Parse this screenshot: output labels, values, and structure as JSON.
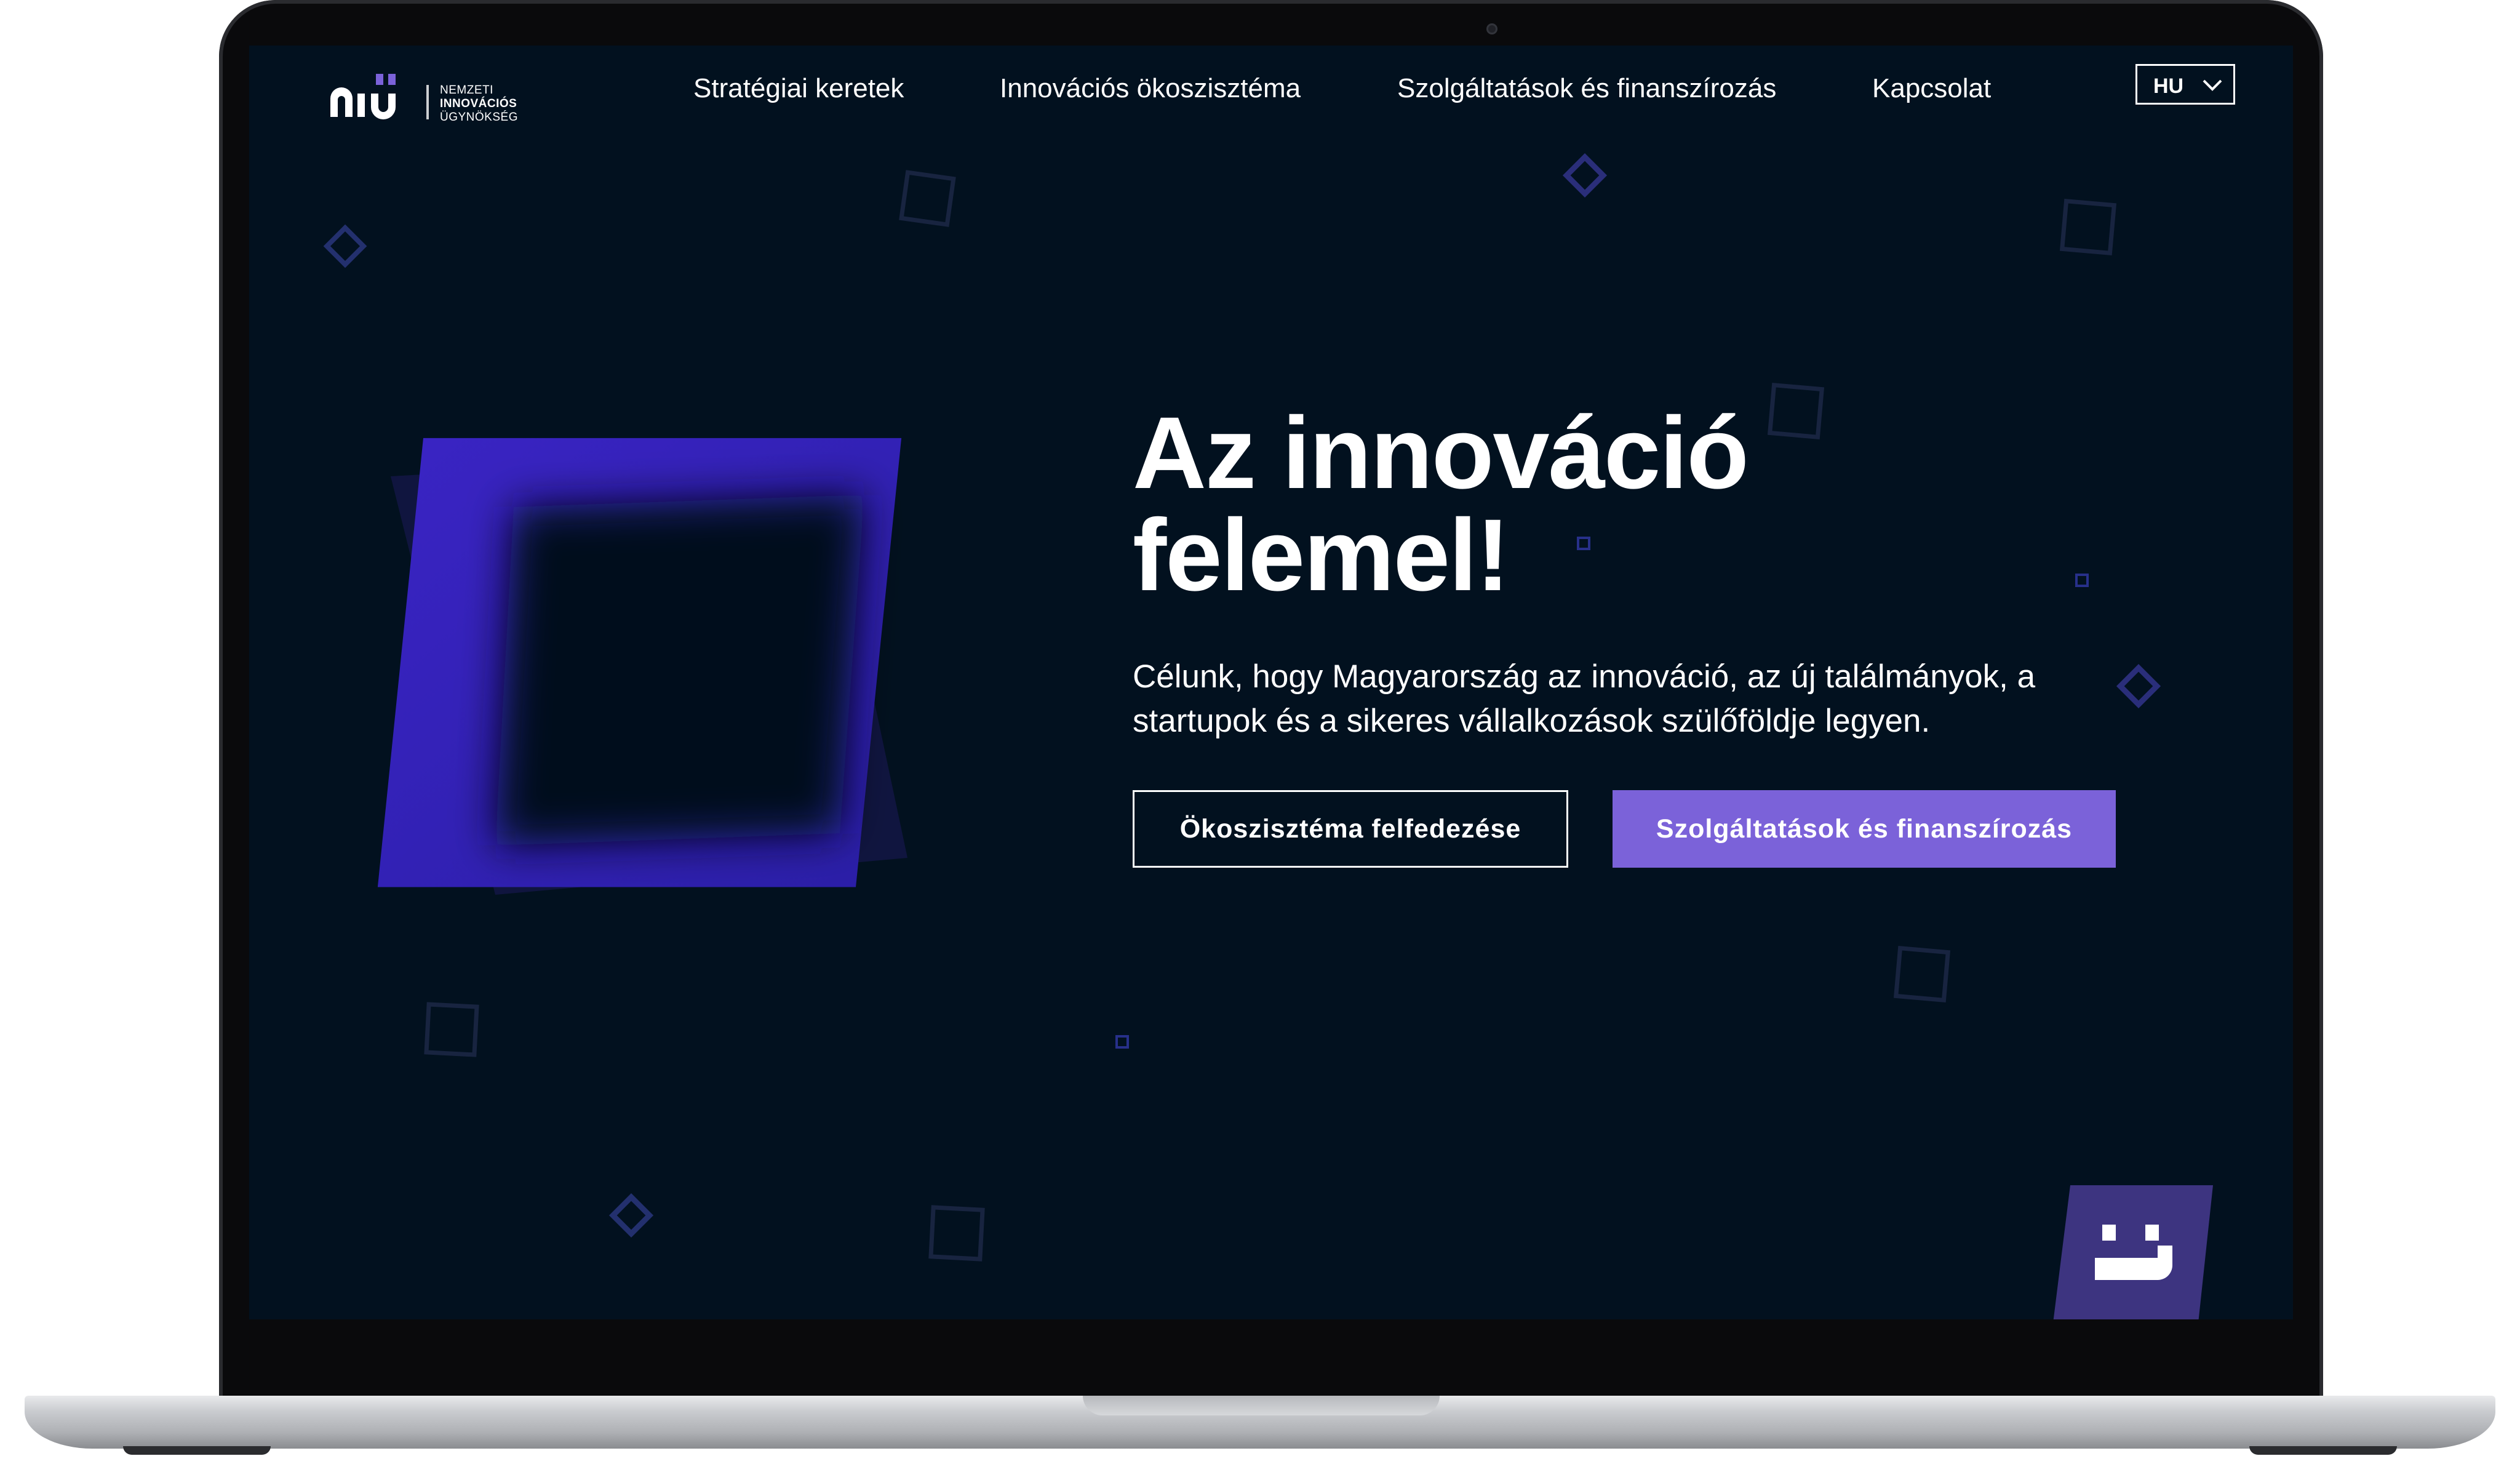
{
  "brand": {
    "logo_lines": [
      "NEMZETI",
      "INNOVÁCIÓS",
      "ÜGYNÖKSÉG"
    ]
  },
  "nav": {
    "items": [
      {
        "label": "Stratégiai keretek"
      },
      {
        "label": "Innovációs ökoszisztéma"
      },
      {
        "label": "Szolgáltatások és finanszírozás"
      },
      {
        "label": "Kapcsolat"
      }
    ],
    "language": "HU"
  },
  "hero": {
    "title_line1": "Az innováció",
    "title_line2": "felemel!",
    "subtitle": "Célunk, hogy Magyarország az innováció, az új találmányok, a startupok és a sikeres vállalkozások szülőföldje legyen.",
    "button_secondary": "Ökoszisztéma felfedezése",
    "button_primary": "Szolgáltatások és finanszírozás"
  },
  "colors": {
    "background": "#02111f",
    "accent": "#7b62d9",
    "graphic_blue": "#3a22c8",
    "badge": "#3d3480"
  },
  "icons": {
    "language_chevron": "chevron-down-icon",
    "chat_badge": "smiley-chat-icon"
  }
}
